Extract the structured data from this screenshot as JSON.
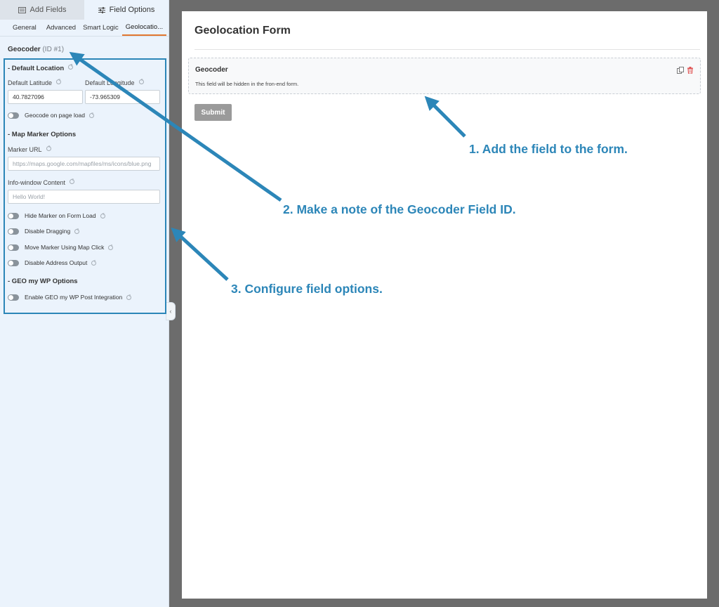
{
  "sidebar": {
    "top_tabs": [
      {
        "label": "Add Fields",
        "icon": "list-icon"
      },
      {
        "label": "Field Options",
        "icon": "sliders-icon"
      }
    ],
    "sub_tabs": [
      "General",
      "Advanced",
      "Smart Logic",
      "Geolocatio..."
    ],
    "field": {
      "name": "Geocoder",
      "id_label": "(ID #1)"
    },
    "sections": {
      "default_location": "- Default Location",
      "map_marker": "- Map Marker Options",
      "geo_my_wp": "- GEO my WP Options"
    },
    "default_latitude": {
      "label": "Default Latitude",
      "value": "40.7827096"
    },
    "default_longitude": {
      "label": "Default Longitude",
      "value": "-73.965309"
    },
    "geocode_on_load": "Geocode on page load",
    "marker_url": {
      "label": "Marker URL",
      "placeholder": "https://maps.google.com/mapfiles/ms/icons/blue.png"
    },
    "info_window": {
      "label": "Info-window Content",
      "placeholder": "Hello World!"
    },
    "toggles": [
      "Hide Marker on Form Load",
      "Disable Dragging",
      "Move Marker Using Map Click",
      "Disable Address Output"
    ],
    "gmw_toggle": "Enable GEO my WP Post Integration",
    "collapse_glyph": "‹"
  },
  "preview": {
    "form_title": "Geolocation Form",
    "field_title": "Geocoder",
    "field_desc": "This field will be hidden in the fron-end form.",
    "submit_label": "Submit"
  },
  "annotations": {
    "step1": "1. Add the field to the form.",
    "step2": "2. Make a note of the Geocoder Field ID.",
    "step3": "3. Configure field options.",
    "color": "#2c86b8"
  },
  "colors": {
    "accent_tab": "#e27730",
    "delete_icon": "#e05555"
  }
}
